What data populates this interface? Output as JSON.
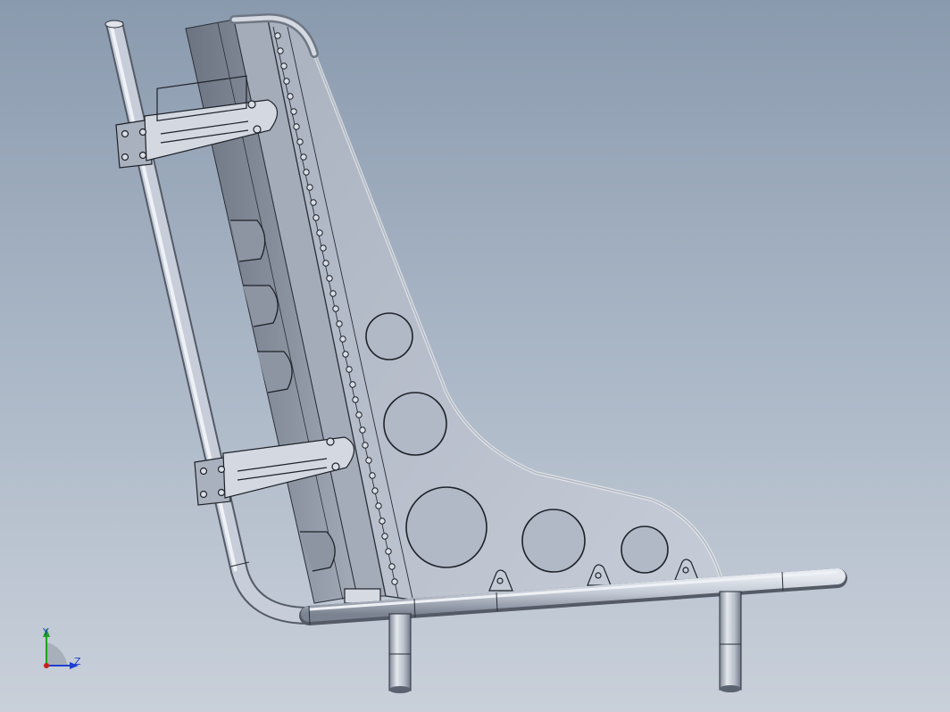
{
  "viewport": {
    "background_top": "#8a9aae",
    "background_bottom": "#c9d0da"
  },
  "model": {
    "part_color": "#b9c0cc",
    "edge_color": "#2a2f38",
    "tube_color": "#c3cad6"
  },
  "triad": {
    "y_label": "Y",
    "z_label": "Z",
    "y_color": "#1fa31f",
    "z_color": "#1f3fd0",
    "origin_color": "#c81e1e"
  }
}
